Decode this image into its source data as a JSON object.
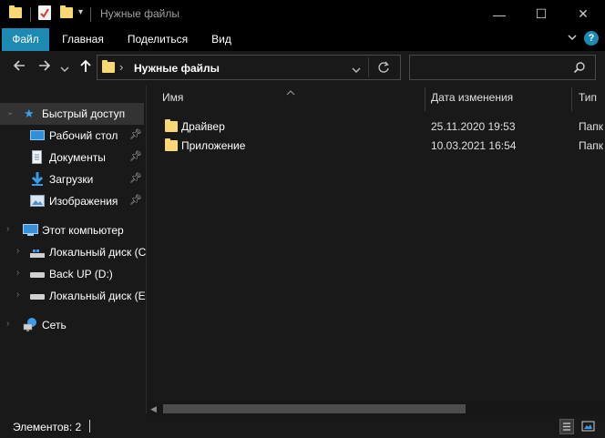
{
  "window": {
    "title": "Нужные файлы",
    "controls": {
      "minimize": "—",
      "maximize": "☐",
      "close": "✕"
    }
  },
  "quick_access_toolbar": {
    "icons": [
      "folder-icon",
      "properties-icon",
      "new-folder-icon",
      "dropdown-icon"
    ]
  },
  "ribbon": {
    "tabs": [
      {
        "label": "Файл",
        "active": true
      },
      {
        "label": "Главная"
      },
      {
        "label": "Поделиться"
      },
      {
        "label": "Вид"
      }
    ],
    "expand_icon": "chevron-down-icon",
    "help_icon": "help-icon",
    "accent_color": "#1c8ab3"
  },
  "address_bar": {
    "path": "Нужные файлы",
    "separator": "›",
    "dropdown_icon": "chevron-down-icon",
    "refresh_icon": "refresh-icon"
  },
  "search": {
    "placeholder": "",
    "icon": "search-icon"
  },
  "sidebar": {
    "quick_access": {
      "label": "Быстрый доступ",
      "items": [
        {
          "label": "Рабочий стол",
          "icon": "desktop-icon",
          "pinned": true
        },
        {
          "label": "Документы",
          "icon": "documents-icon",
          "pinned": true
        },
        {
          "label": "Загрузки",
          "icon": "downloads-icon",
          "pinned": true
        },
        {
          "label": "Изображения",
          "icon": "pictures-icon",
          "pinned": true
        }
      ]
    },
    "this_pc": {
      "label": "Этот компьютер",
      "drives": [
        {
          "label": "Локальный диск (C",
          "icon": "system-drive-icon"
        },
        {
          "label": "Back UP (D:)",
          "icon": "drive-icon"
        },
        {
          "label": "Локальный диск (E",
          "icon": "drive-icon"
        }
      ]
    },
    "network": {
      "label": "Сеть"
    }
  },
  "content": {
    "columns": [
      "Имя",
      "Дата изменения",
      "Тип"
    ],
    "rows": [
      {
        "name": "Драйвер",
        "date": "25.11.2020 19:53",
        "type": "Папк"
      },
      {
        "name": "Приложение",
        "date": "10.03.2021 16:54",
        "type": "Папк"
      }
    ]
  },
  "statusbar": {
    "items_count": "Элементов: 2"
  }
}
